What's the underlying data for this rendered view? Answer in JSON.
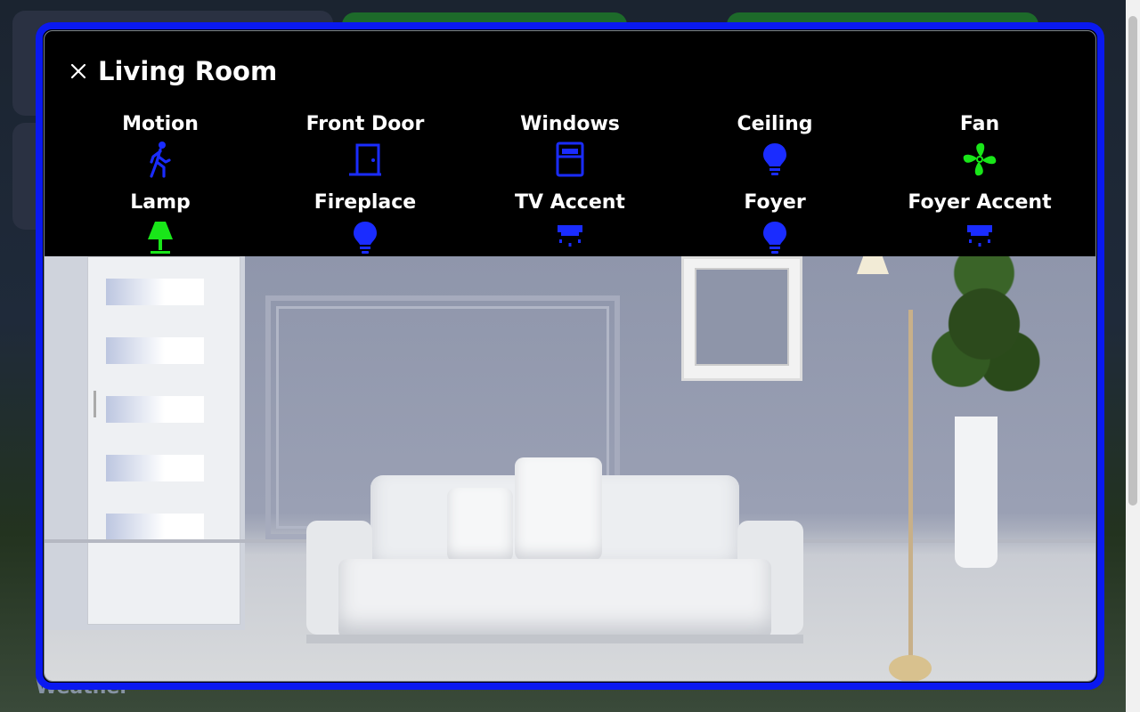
{
  "dialog": {
    "title": "Living Room",
    "accent_color": "#0a19f0"
  },
  "background": {
    "weather_label": "Weather"
  },
  "entities": [
    {
      "label": "Motion",
      "icon": "motion-sensor-icon",
      "color": "#1a2cff",
      "state": "off"
    },
    {
      "label": "Front Door",
      "icon": "door-icon",
      "color": "#1a2cff",
      "state": "off"
    },
    {
      "label": "Windows",
      "icon": "window-icon",
      "color": "#1a2cff",
      "state": "off"
    },
    {
      "label": "Ceiling",
      "icon": "lightbulb-icon",
      "color": "#1a2cff",
      "state": "off"
    },
    {
      "label": "Fan",
      "icon": "fan-icon",
      "color": "#19e619",
      "state": "on"
    },
    {
      "label": "Lamp",
      "icon": "lamp-icon",
      "color": "#19e619",
      "state": "on"
    },
    {
      "label": "Fireplace",
      "icon": "lightbulb-icon",
      "color": "#1a2cff",
      "state": "off"
    },
    {
      "label": "TV Accent",
      "icon": "led-strip-icon",
      "color": "#1a2cff",
      "state": "off"
    },
    {
      "label": "Foyer",
      "icon": "lightbulb-icon",
      "color": "#1a2cff",
      "state": "off"
    },
    {
      "label": "Foyer Accent",
      "icon": "led-strip-icon",
      "color": "#1a2cff",
      "state": "off"
    }
  ]
}
